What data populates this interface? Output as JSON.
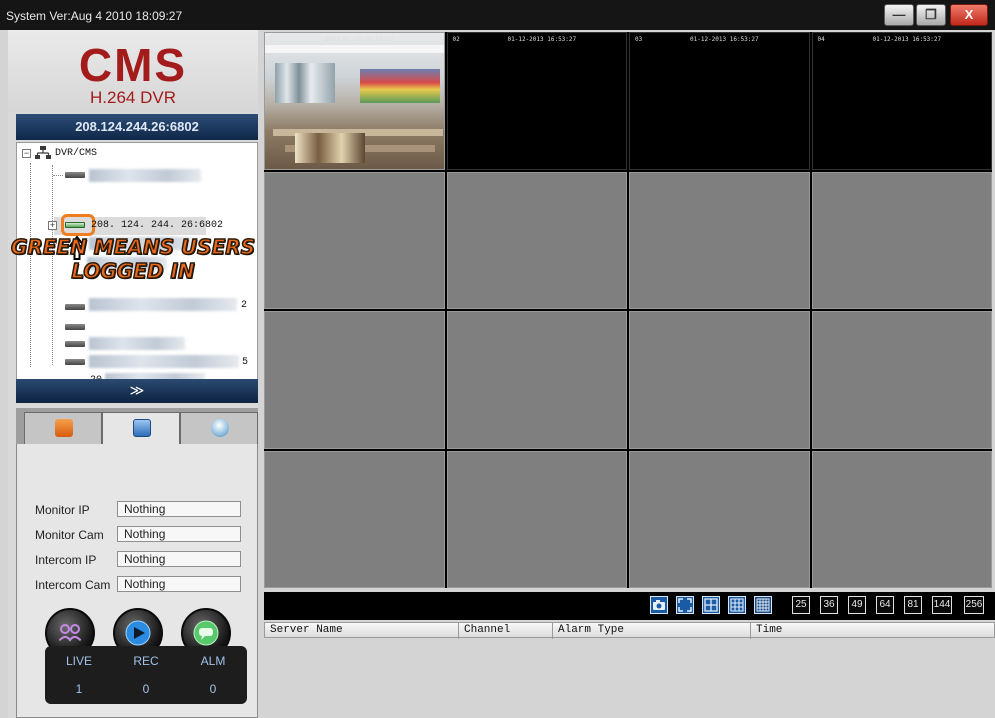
{
  "window": {
    "version_text": "System Ver:Aug  4 2010 18:09:27",
    "minimize_label": "—",
    "restore_label": "❐",
    "close_label": "X"
  },
  "logo": {
    "title": "CMS",
    "subtitle": "H.264 DVR"
  },
  "device_bar": {
    "address": "208.124.244.26:6802"
  },
  "tree": {
    "root_label": "DVR/CMS",
    "selected_device": "208. 124. 244. 26:6802",
    "partial_labels": [
      "2",
      "5",
      "20"
    ]
  },
  "annotation": {
    "line1": "GREEN MEANS USERS",
    "line2": "LOGGED IN"
  },
  "expand": {
    "label": "≫"
  },
  "tabs": [
    {
      "name": "device-list",
      "color": "#e8761e"
    },
    {
      "name": "monitor",
      "color": "#3b7fc9"
    },
    {
      "name": "ptz-camera",
      "color": "#8fbde0"
    }
  ],
  "monitor": {
    "fields": [
      {
        "label": "Monitor IP",
        "value": "Nothing"
      },
      {
        "label": "Monitor Cam",
        "value": "Nothing"
      },
      {
        "label": "Intercom IP",
        "value": "Nothing"
      },
      {
        "label": "Intercom Cam",
        "value": "Nothing"
      }
    ],
    "buttons": [
      {
        "name": "users-icon",
        "color": "#b07ad0"
      },
      {
        "name": "play-icon",
        "color": "#2a8be0"
      },
      {
        "name": "chat-icon",
        "color": "#57c96a"
      }
    ]
  },
  "counters": [
    {
      "label": "LIVE",
      "value": "1"
    },
    {
      "label": "REC",
      "value": "0"
    },
    {
      "label": "ALM",
      "value": "0"
    }
  ],
  "video": {
    "osd": [
      {
        "num": "1",
        "timestamp": "2013 01 12 16:53:27"
      },
      {
        "num": "02",
        "timestamp": "01-12-2013 16:53:27"
      },
      {
        "num": "03",
        "timestamp": "01-12-2013 16:53:27"
      },
      {
        "num": "04",
        "timestamp": "01-12-2013 16:53:27"
      }
    ]
  },
  "layout_toolbar": {
    "icons": [
      "capture-icon",
      "fullscreen-icon",
      "grid-4-icon",
      "grid-9-icon",
      "grid-16-icon"
    ],
    "counts": [
      "25",
      "36",
      "49",
      "64",
      "81",
      "144",
      "256"
    ]
  },
  "alarm_table": {
    "columns": [
      "Server Name",
      "Channel",
      "Alarm Type",
      "Time"
    ]
  },
  "colors": {
    "accent_red": "#a31b1b",
    "bar_blue": "#1c3a62",
    "highlight_orange": "#f07d20",
    "online_green": "#5aa25a"
  }
}
